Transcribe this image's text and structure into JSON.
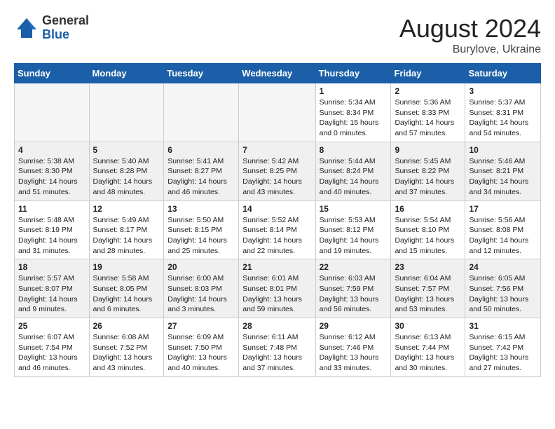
{
  "header": {
    "logo_general": "General",
    "logo_blue": "Blue",
    "month_year": "August 2024",
    "location": "Burylove, Ukraine"
  },
  "days_of_week": [
    "Sunday",
    "Monday",
    "Tuesday",
    "Wednesday",
    "Thursday",
    "Friday",
    "Saturday"
  ],
  "weeks": [
    [
      {
        "day": "",
        "info": "",
        "empty": true
      },
      {
        "day": "",
        "info": "",
        "empty": true
      },
      {
        "day": "",
        "info": "",
        "empty": true
      },
      {
        "day": "",
        "info": "",
        "empty": true
      },
      {
        "day": "1",
        "info": "Sunrise: 5:34 AM\nSunset: 8:34 PM\nDaylight: 15 hours\nand 0 minutes."
      },
      {
        "day": "2",
        "info": "Sunrise: 5:36 AM\nSunset: 8:33 PM\nDaylight: 14 hours\nand 57 minutes."
      },
      {
        "day": "3",
        "info": "Sunrise: 5:37 AM\nSunset: 8:31 PM\nDaylight: 14 hours\nand 54 minutes."
      }
    ],
    [
      {
        "day": "4",
        "info": "Sunrise: 5:38 AM\nSunset: 8:30 PM\nDaylight: 14 hours\nand 51 minutes."
      },
      {
        "day": "5",
        "info": "Sunrise: 5:40 AM\nSunset: 8:28 PM\nDaylight: 14 hours\nand 48 minutes."
      },
      {
        "day": "6",
        "info": "Sunrise: 5:41 AM\nSunset: 8:27 PM\nDaylight: 14 hours\nand 46 minutes."
      },
      {
        "day": "7",
        "info": "Sunrise: 5:42 AM\nSunset: 8:25 PM\nDaylight: 14 hours\nand 43 minutes."
      },
      {
        "day": "8",
        "info": "Sunrise: 5:44 AM\nSunset: 8:24 PM\nDaylight: 14 hours\nand 40 minutes."
      },
      {
        "day": "9",
        "info": "Sunrise: 5:45 AM\nSunset: 8:22 PM\nDaylight: 14 hours\nand 37 minutes."
      },
      {
        "day": "10",
        "info": "Sunrise: 5:46 AM\nSunset: 8:21 PM\nDaylight: 14 hours\nand 34 minutes."
      }
    ],
    [
      {
        "day": "11",
        "info": "Sunrise: 5:48 AM\nSunset: 8:19 PM\nDaylight: 14 hours\nand 31 minutes."
      },
      {
        "day": "12",
        "info": "Sunrise: 5:49 AM\nSunset: 8:17 PM\nDaylight: 14 hours\nand 28 minutes."
      },
      {
        "day": "13",
        "info": "Sunrise: 5:50 AM\nSunset: 8:15 PM\nDaylight: 14 hours\nand 25 minutes."
      },
      {
        "day": "14",
        "info": "Sunrise: 5:52 AM\nSunset: 8:14 PM\nDaylight: 14 hours\nand 22 minutes."
      },
      {
        "day": "15",
        "info": "Sunrise: 5:53 AM\nSunset: 8:12 PM\nDaylight: 14 hours\nand 19 minutes."
      },
      {
        "day": "16",
        "info": "Sunrise: 5:54 AM\nSunset: 8:10 PM\nDaylight: 14 hours\nand 15 minutes."
      },
      {
        "day": "17",
        "info": "Sunrise: 5:56 AM\nSunset: 8:08 PM\nDaylight: 14 hours\nand 12 minutes."
      }
    ],
    [
      {
        "day": "18",
        "info": "Sunrise: 5:57 AM\nSunset: 8:07 PM\nDaylight: 14 hours\nand 9 minutes."
      },
      {
        "day": "19",
        "info": "Sunrise: 5:58 AM\nSunset: 8:05 PM\nDaylight: 14 hours\nand 6 minutes."
      },
      {
        "day": "20",
        "info": "Sunrise: 6:00 AM\nSunset: 8:03 PM\nDaylight: 14 hours\nand 3 minutes."
      },
      {
        "day": "21",
        "info": "Sunrise: 6:01 AM\nSunset: 8:01 PM\nDaylight: 13 hours\nand 59 minutes."
      },
      {
        "day": "22",
        "info": "Sunrise: 6:03 AM\nSunset: 7:59 PM\nDaylight: 13 hours\nand 56 minutes."
      },
      {
        "day": "23",
        "info": "Sunrise: 6:04 AM\nSunset: 7:57 PM\nDaylight: 13 hours\nand 53 minutes."
      },
      {
        "day": "24",
        "info": "Sunrise: 6:05 AM\nSunset: 7:56 PM\nDaylight: 13 hours\nand 50 minutes."
      }
    ],
    [
      {
        "day": "25",
        "info": "Sunrise: 6:07 AM\nSunset: 7:54 PM\nDaylight: 13 hours\nand 46 minutes."
      },
      {
        "day": "26",
        "info": "Sunrise: 6:08 AM\nSunset: 7:52 PM\nDaylight: 13 hours\nand 43 minutes."
      },
      {
        "day": "27",
        "info": "Sunrise: 6:09 AM\nSunset: 7:50 PM\nDaylight: 13 hours\nand 40 minutes."
      },
      {
        "day": "28",
        "info": "Sunrise: 6:11 AM\nSunset: 7:48 PM\nDaylight: 13 hours\nand 37 minutes."
      },
      {
        "day": "29",
        "info": "Sunrise: 6:12 AM\nSunset: 7:46 PM\nDaylight: 13 hours\nand 33 minutes."
      },
      {
        "day": "30",
        "info": "Sunrise: 6:13 AM\nSunset: 7:44 PM\nDaylight: 13 hours\nand 30 minutes."
      },
      {
        "day": "31",
        "info": "Sunrise: 6:15 AM\nSunset: 7:42 PM\nDaylight: 13 hours\nand 27 minutes."
      }
    ]
  ]
}
